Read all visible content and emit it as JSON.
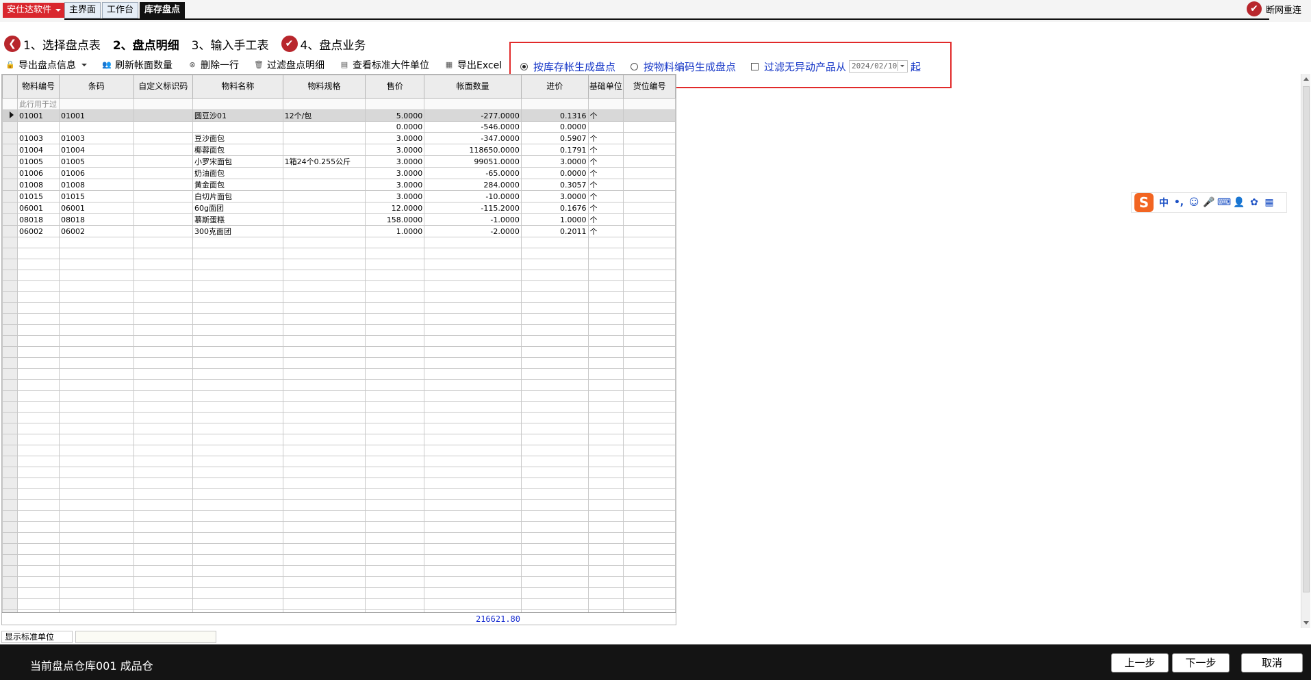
{
  "app": {
    "brand": "安仕达软件",
    "tabs": [
      "主界面",
      "工作台",
      "库存盘点"
    ],
    "disconnect_label": "断网重连"
  },
  "steps": [
    {
      "label": "1、选择盘点表",
      "state": "done"
    },
    {
      "label": "2、盘点明细",
      "state": "current"
    },
    {
      "label": "3、输入手工表",
      "state": "pending"
    },
    {
      "label": "4、盘点业务",
      "state": "done"
    }
  ],
  "toolbar": {
    "export_info": "导出盘点信息",
    "refresh": "刷新帐面数量",
    "delete_row": "删除一行",
    "filter_detail": "过滤盘点明细",
    "view_units": "查看标准大件单位",
    "export_excel": "导出Excel"
  },
  "options": {
    "by_stock": "按库存帐生成盘点",
    "by_code": "按物料编码生成盘点",
    "filter_static": "过滤无异动产品从",
    "date": "2024/02/10",
    "suffix": "起",
    "selected": "by_stock"
  },
  "grid": {
    "columns": [
      "物料编号",
      "条码",
      "自定义标识码",
      "物料名称",
      "物料规格",
      "售价",
      "帐面数量",
      "进价",
      "基础单位",
      "货位编号"
    ],
    "filter_row_text": "此行用于过",
    "rows": [
      [
        "01001",
        "01001",
        "",
        "圆豆沙01",
        "12个/包",
        "5.0000",
        "-277.0000",
        "0.1316",
        "个",
        ""
      ],
      [
        "",
        "",
        "",
        "",
        "",
        "0.0000",
        "-546.0000",
        "0.0000",
        "",
        ""
      ],
      [
        "01003",
        "01003",
        "",
        "豆沙面包",
        "",
        "3.0000",
        "-347.0000",
        "0.5907",
        "个",
        ""
      ],
      [
        "01004",
        "01004",
        "",
        "椰蓉面包",
        "",
        "3.0000",
        "118650.0000",
        "0.1791",
        "个",
        ""
      ],
      [
        "01005",
        "01005",
        "",
        "小罗宋面包",
        "1箱24个0.255公斤",
        "3.0000",
        "99051.0000",
        "3.0000",
        "个",
        ""
      ],
      [
        "01006",
        "01006",
        "",
        "奶油面包",
        "",
        "3.0000",
        "-65.0000",
        "0.0000",
        "个",
        ""
      ],
      [
        "01008",
        "01008",
        "",
        "黄金面包",
        "",
        "3.0000",
        "284.0000",
        "0.3057",
        "个",
        ""
      ],
      [
        "01015",
        "01015",
        "",
        "白切片面包",
        "",
        "3.0000",
        "-10.0000",
        "3.0000",
        "个",
        ""
      ],
      [
        "06001",
        "06001",
        "",
        "60g面团",
        "",
        "12.0000",
        "-115.2000",
        "0.1676",
        "个",
        ""
      ],
      [
        "08018",
        "08018",
        "",
        "慕斯蛋糕",
        "",
        "158.0000",
        "-1.0000",
        "1.0000",
        "个",
        ""
      ],
      [
        "06002",
        "06002",
        "",
        "300克面团",
        "",
        "1.0000",
        "-2.0000",
        "0.2011",
        "个",
        ""
      ]
    ],
    "total_book_qty": "216621.80"
  },
  "status": {
    "unit_label": "显示标准单位",
    "warehouse": "当前盘点仓库001 成品仓"
  },
  "buttons": {
    "prev": "上一步",
    "next": "下一步",
    "cancel": "取消"
  },
  "ime": {
    "mode": "中",
    "punct": "•,"
  }
}
